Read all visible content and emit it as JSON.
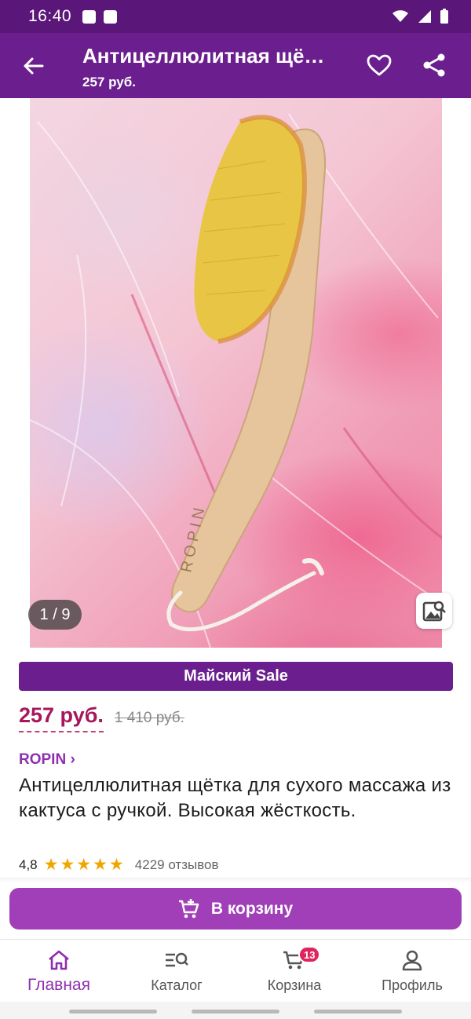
{
  "status_bar": {
    "time": "16:40"
  },
  "app_bar": {
    "title": "Антицеллюлитная щё…",
    "price": "257 руб."
  },
  "gallery": {
    "counter": "1 / 9",
    "brand_on_handle": "ROPIN"
  },
  "sale_banner": "Майский Sale",
  "price": {
    "current": "257 руб.",
    "old": "1 410 руб."
  },
  "brand": {
    "label": "ROPIN ›"
  },
  "product": {
    "title": "Антицеллюлитная щётка для сухого массажа из кактуса с ручкой. Высокая жёсткость."
  },
  "rating": {
    "value": "4,8",
    "stars": 5,
    "reviews": "4229 отзывов"
  },
  "cart_button": {
    "label": "В корзину"
  },
  "bottom_nav": {
    "items": [
      {
        "label": "Главная",
        "icon": "home-icon"
      },
      {
        "label": "Каталог",
        "icon": "catalog-search-icon"
      },
      {
        "label": "Корзина",
        "icon": "cart-icon",
        "badge": "13"
      },
      {
        "label": "Профиль",
        "icon": "profile-icon"
      }
    ]
  },
  "colors": {
    "brand_purple": "#6b1f8f",
    "button_purple": "#a13fb8",
    "price_red": "#a6185a",
    "star": "#f0a500",
    "badge": "#e0245e"
  }
}
